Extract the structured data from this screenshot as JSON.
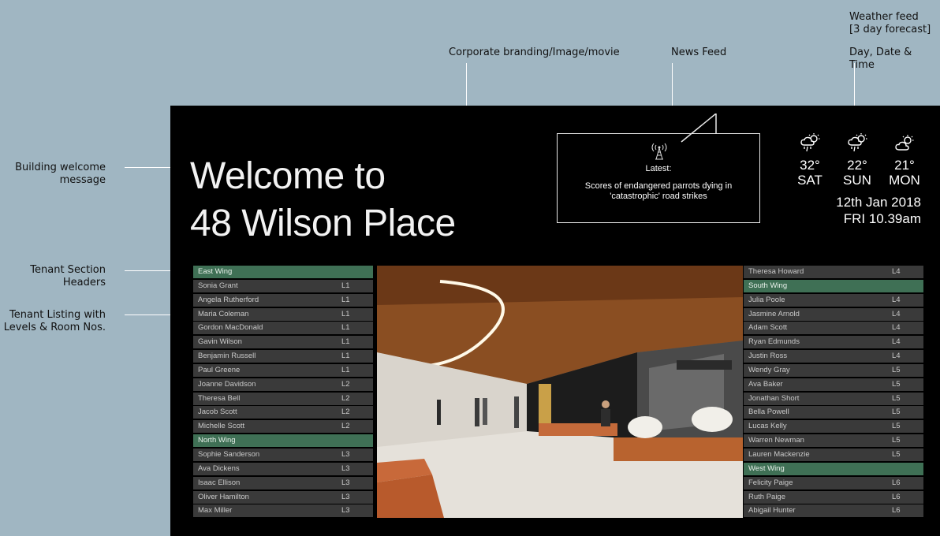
{
  "annotations": {
    "weather_feed": "Weather feed",
    "weather_feed_sub": "[3 day forecast]",
    "day_date_time": "Day, Date & Time",
    "corporate": "Corporate branding/Image/movie",
    "news_feed": "News Feed",
    "building_welcome": "Building welcome message",
    "tenant_headers": "Tenant Section Headers",
    "tenant_listing": "Tenant Listing with Levels & Room Nos."
  },
  "welcome": {
    "line1": "Welcome to",
    "line2": "48 Wilson Place"
  },
  "news": {
    "icon": "broadcast-tower-icon",
    "latest": "Latest:",
    "text": "Scores of endangered parrots dying in 'catastrophic' road strikes"
  },
  "weather": [
    {
      "icon": "thunderstorm-icon",
      "temp": "32°",
      "day": "SAT"
    },
    {
      "icon": "thunderstorm-icon",
      "temp": "22°",
      "day": "SUN"
    },
    {
      "icon": "partly-cloudy-icon",
      "temp": "21°",
      "day": "MON"
    }
  ],
  "datetime": {
    "date": "12th Jan 2018",
    "time": "FRI 10.39am"
  },
  "left_list": [
    {
      "name": "East Wing",
      "level": "",
      "header": true
    },
    {
      "name": "Sonia Grant",
      "level": "L1"
    },
    {
      "name": "Angela Rutherford",
      "level": "L1"
    },
    {
      "name": "Maria Coleman",
      "level": "L1"
    },
    {
      "name": "Gordon MacDonald",
      "level": "L1"
    },
    {
      "name": "Gavin Wilson",
      "level": "L1"
    },
    {
      "name": "Benjamin Russell",
      "level": "L1"
    },
    {
      "name": "Paul Greene",
      "level": "L1"
    },
    {
      "name": "Joanne Davidson",
      "level": "L2"
    },
    {
      "name": "Theresa Bell",
      "level": "L2"
    },
    {
      "name": "Jacob Scott",
      "level": "L2"
    },
    {
      "name": "Michelle Scott",
      "level": "L2"
    },
    {
      "name": "North Wing",
      "level": "",
      "header": true
    },
    {
      "name": "Sophie Sanderson",
      "level": "L3"
    },
    {
      "name": "Ava Dickens",
      "level": "L3"
    },
    {
      "name": "Isaac Ellison",
      "level": "L3"
    },
    {
      "name": "Oliver Hamilton",
      "level": "L3"
    },
    {
      "name": "Max Miller",
      "level": "L3"
    }
  ],
  "right_list": [
    {
      "name": "Theresa Howard",
      "level": "L4"
    },
    {
      "name": "South Wing",
      "level": "",
      "header": true
    },
    {
      "name": "Julia Poole",
      "level": "L4"
    },
    {
      "name": "Jasmine Arnold",
      "level": "L4"
    },
    {
      "name": "Adam Scott",
      "level": "L4"
    },
    {
      "name": "Ryan Edmunds",
      "level": "L4"
    },
    {
      "name": "Justin Ross",
      "level": "L4"
    },
    {
      "name": "Wendy Gray",
      "level": "L5"
    },
    {
      "name": "Ava Baker",
      "level": "L5"
    },
    {
      "name": "Jonathan Short",
      "level": "L5"
    },
    {
      "name": "Bella Powell",
      "level": "L5"
    },
    {
      "name": "Lucas Kelly",
      "level": "L5"
    },
    {
      "name": "Warren Newman",
      "level": "L5"
    },
    {
      "name": "Lauren Mackenzie",
      "level": "L5"
    },
    {
      "name": "West Wing",
      "level": "",
      "header": true
    },
    {
      "name": "Felicity Paige",
      "level": "L6"
    },
    {
      "name": "Ruth Paige",
      "level": "L6"
    },
    {
      "name": "Abigail Hunter",
      "level": "L6"
    }
  ],
  "colors": {
    "background": "#a0b6c2",
    "screen": "#000000",
    "row": "#3a3a3a",
    "header_row": "#3f7055"
  }
}
